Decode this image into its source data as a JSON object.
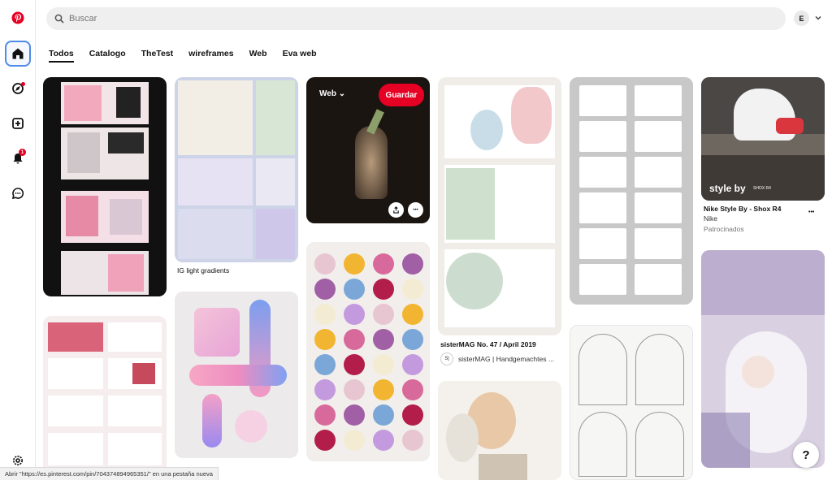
{
  "search": {
    "placeholder": "Buscar"
  },
  "account": {
    "initial": "E"
  },
  "tabs": [
    {
      "label": "Todos",
      "active": true
    },
    {
      "label": "Catalogo"
    },
    {
      "label": "TheTest"
    },
    {
      "label": "wireframes"
    },
    {
      "label": "Web"
    },
    {
      "label": "Eva web"
    }
  ],
  "sidebar": {
    "notifications_badge": "1",
    "items": [
      "pinterest-logo-icon",
      "home-icon",
      "explore-icon",
      "create-icon",
      "notifications-icon",
      "messages-icon",
      "settings-icon"
    ]
  },
  "pins": {
    "ig_gradients_title": "IG light gradients",
    "overlay_board": "Web",
    "overlay_save": "Guardar",
    "sistermag_title": "sisterMAG No. 47 / April 2019",
    "sistermag_source": "sisterMAG | Handgemachtes ...",
    "sistermag_avatar": "S|",
    "nike_title": "Nike Style By - Shox R4",
    "nike_brand": "Nike",
    "nike_promoted": "Patrocinados",
    "nike_image_text": "style by",
    "nike_image_small": "SHOX R4",
    "more_glyph": "•••"
  },
  "status_bar": "Abrir \"https://es.pinterest.com/pin/704374894965351/\" en una pestaña nueva",
  "help": "?",
  "colors": {
    "brand": "#e60023",
    "focus": "#4f8ae8"
  }
}
